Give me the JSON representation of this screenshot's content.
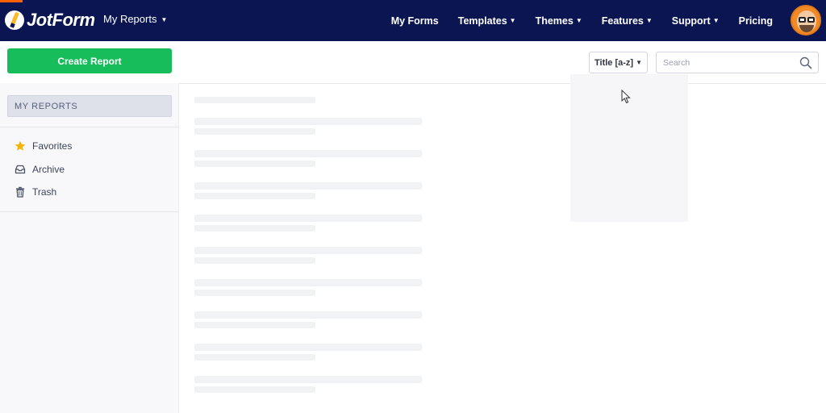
{
  "header": {
    "logo_text": "JotForm",
    "section_menu": "My Reports",
    "nav": [
      {
        "label": "My Forms",
        "has_caret": false
      },
      {
        "label": "Templates",
        "has_caret": true
      },
      {
        "label": "Themes",
        "has_caret": true
      },
      {
        "label": "Features",
        "has_caret": true
      },
      {
        "label": "Support",
        "has_caret": true
      },
      {
        "label": "Pricing",
        "has_caret": false
      }
    ],
    "colors": {
      "bar": "#0a1551",
      "accent": "#ff6100"
    }
  },
  "toolbar": {
    "create_label": "Create Report",
    "sort_label": "Title [a-z]",
    "search_placeholder": "Search",
    "search_icon": "search-icon",
    "create_color": "#18bd5b"
  },
  "sidebar": {
    "header": "MY REPORTS",
    "items": [
      {
        "label": "Favorites",
        "icon": "star-icon"
      },
      {
        "label": "Archive",
        "icon": "archive-icon"
      },
      {
        "label": "Trash",
        "icon": "trash-icon"
      }
    ]
  },
  "main": {
    "state": "loading"
  }
}
